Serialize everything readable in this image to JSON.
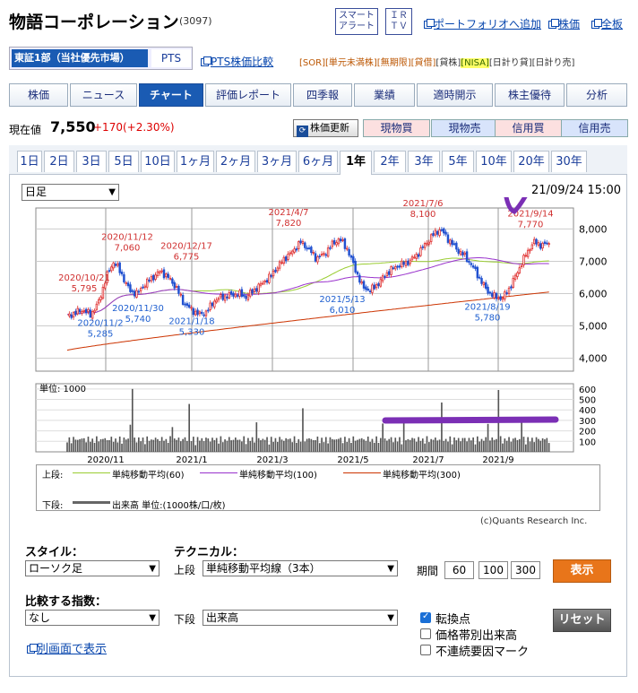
{
  "header": {
    "company_name": "物語コーポレーション",
    "code": "(3097)",
    "smart_alert": [
      "スマート",
      "アラート"
    ],
    "ir_tv": [
      "ＩＲ",
      "ＴＶ"
    ],
    "portfolio_add": "ポートフォリオへ追加",
    "stock_price_link": "株価",
    "board_link": "全板"
  },
  "market": {
    "primary": "東証1部（当社優先市場）",
    "pts": "PTS",
    "pts_compare": "PTS株価比較",
    "tags": [
      "[SOR]",
      "[単元未満株]",
      "[無期限]",
      "[貸借]",
      "[貸株]",
      "[NISA]",
      "[日計り貸]",
      "[日計り売]"
    ]
  },
  "nav_tabs": [
    "株価",
    "ニュース",
    "チャート",
    "評価レポート",
    "四季報",
    "業績",
    "適時開示",
    "株主優待",
    "分析"
  ],
  "price": {
    "label": "現在値",
    "value": "7,550",
    "change": "+170",
    "change_pct": "(+2.30%)",
    "refresh": "株価更新",
    "buy_cash": "現物買",
    "sell_cash": "現物売",
    "buy_margin": "信用買",
    "sell_margin": "信用売"
  },
  "period_tabs": [
    "1日",
    "2日",
    "3日",
    "5日",
    "10日",
    "1ヶ月",
    "2ヶ月",
    "3ヶ月",
    "6ヶ月",
    "1年",
    "2年",
    "3年",
    "5年",
    "10年",
    "20年",
    "30年"
  ],
  "chart_controls": {
    "interval": "日足",
    "datetime": "21/09/24 15:00"
  },
  "chart_data": {
    "type": "candlestick",
    "y_ticks": [
      "8,000",
      "7,000",
      "6,000",
      "5,000",
      "4,000"
    ],
    "x_ticks": [
      "2020/11",
      "2021/1",
      "2021/3",
      "2021/5",
      "2021/7",
      "2021/9"
    ],
    "annotations": [
      {
        "date": "2020/10/21",
        "value": "5,795"
      },
      {
        "date": "2020/11/12",
        "value": "7,060"
      },
      {
        "date": "2020/12/17",
        "value": "6,775"
      },
      {
        "date": "2020/11/2",
        "value": "5,285"
      },
      {
        "date": "2020/11/30",
        "value": "5,740"
      },
      {
        "date": "2021/1/18",
        "value": "5,330"
      },
      {
        "date": "2021/4/7",
        "value": "7,820"
      },
      {
        "date": "2021/5/13",
        "value": "6,010"
      },
      {
        "date": "2021/7/6",
        "value": "8,100"
      },
      {
        "date": "2021/8/19",
        "value": "5,780"
      },
      {
        "date": "2021/9/14",
        "value": "7,770"
      }
    ],
    "close_series": [
      5300,
      5400,
      5500,
      5350,
      5700,
      6500,
      7000,
      6600,
      6100,
      6000,
      6300,
      6500,
      6700,
      6500,
      6200,
      5700,
      5500,
      5350,
      5450,
      5800,
      5900,
      5950,
      6000,
      5900,
      6100,
      6300,
      6500,
      6800,
      7100,
      7300,
      7600,
      7400,
      7100,
      7200,
      7500,
      7700,
      7400,
      6800,
      6200,
      6100,
      6300,
      6600,
      6800,
      6900,
      7000,
      7200,
      7500,
      7800,
      8000,
      7700,
      7400,
      7200,
      6900,
      6500,
      6100,
      5900,
      5850,
      6200,
      6700,
      7200,
      7600,
      7500,
      7550
    ],
    "volume_unit": "単位: 1000",
    "volume_ticks": [
      "600",
      "500",
      "400",
      "300",
      "200",
      "100"
    ],
    "legend_upper": [
      "上段:",
      "単純移動平均(60)",
      "単純移動平均(100)",
      "単純移動平均(300)"
    ],
    "legend_lower": [
      "下段:",
      "出来高 単位:(1000株/口/枚)"
    ],
    "colors": {
      "ma60": "#9acd32",
      "ma100": "#9932cc",
      "ma300": "#cc3300",
      "up": "#e03030",
      "down": "#2050d0"
    },
    "credit": "(c)Quants Research Inc."
  },
  "settings": {
    "style_label": "スタイル：",
    "style_value": "ローソク足",
    "technical_label": "テクニカル：",
    "upper_label": "上段",
    "upper_value": "単純移動平均線（3本）",
    "period_label": "期間",
    "periods": [
      "60",
      "100",
      "300"
    ],
    "show_button": "表示",
    "index_label": "比較する指数：",
    "index_value": "なし",
    "lower_label": "下段",
    "lower_value": "出来高",
    "reset_button": "リセット",
    "options": [
      {
        "label": "転換点",
        "checked": true
      },
      {
        "label": "価格帯別出来高",
        "checked": false
      },
      {
        "label": "不連続要因マーク",
        "checked": false
      }
    ],
    "separate_window": "別画面で表示"
  }
}
